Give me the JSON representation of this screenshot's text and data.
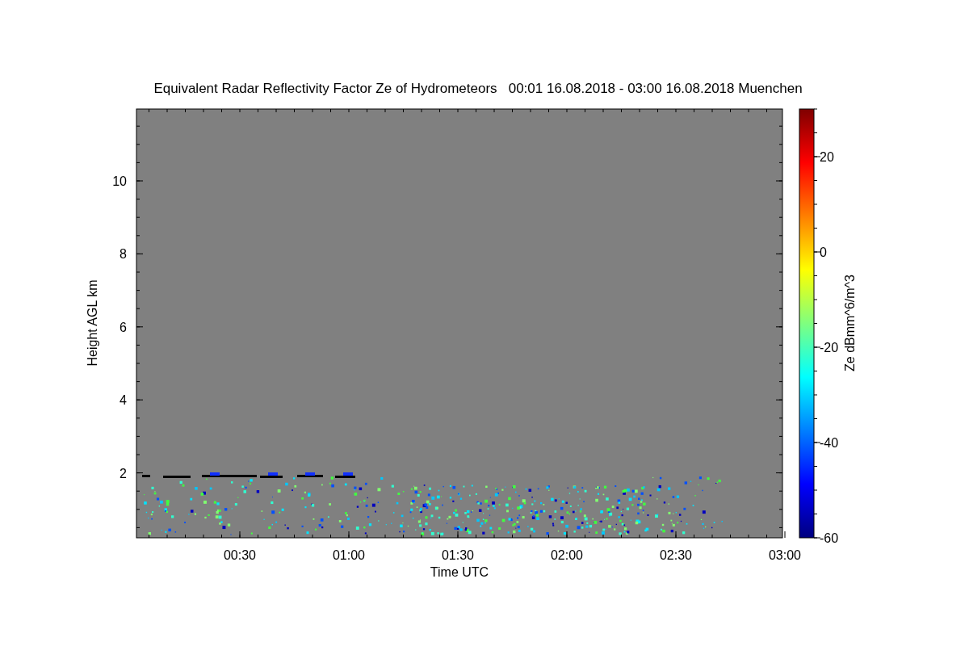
{
  "title": "Equivalent Radar Reflectivity Factor Ze of Hydrometeors   00:01 16.08.2018 - 03:00 16.08.2018 Muenchen",
  "y_axis": {
    "label": "Height AGL km",
    "ticks": [
      "10",
      "8",
      "6",
      "4",
      "2"
    ]
  },
  "x_axis": {
    "label": "Time UTC",
    "ticks": [
      "00:30",
      "01:00",
      "01:30",
      "02:00",
      "02:30",
      "03:00"
    ]
  },
  "colorbar": {
    "label": "Ze dBmm^6/m^3",
    "ticks": [
      "20",
      "0",
      "-20",
      "-40",
      "-60"
    ]
  }
}
